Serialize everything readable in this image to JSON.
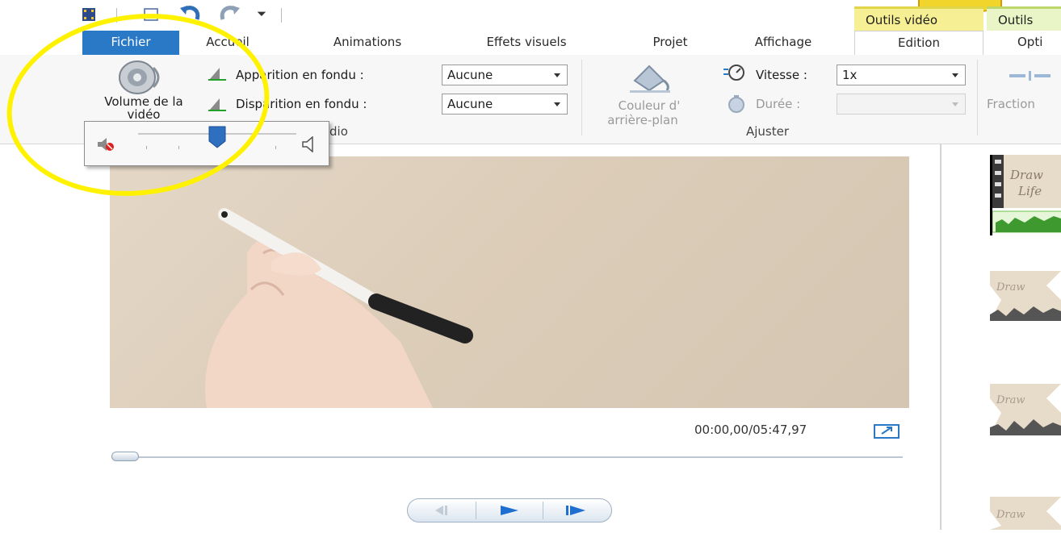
{
  "context_tabs": {
    "video_tools": "Outils vidéo",
    "other_tools": "Outils"
  },
  "tabs": [
    {
      "label": "Fichier"
    },
    {
      "label": "Accueil"
    },
    {
      "label": "Animations"
    },
    {
      "label": "Effets visuels"
    },
    {
      "label": "Projet"
    },
    {
      "label": "Affichage"
    },
    {
      "label": "Edition"
    },
    {
      "label": "Opti"
    }
  ],
  "ribbon": {
    "volume_button_label": "Volume de la vidéo",
    "fade_in_label": "Apparition en fondu :",
    "fade_in_value": "Aucune",
    "fade_out_label": "Disparition en fondu :",
    "fade_out_value": "Aucune",
    "audio_group_label": "dio",
    "bg_color_label": "Couleur d'",
    "bg_color_label_2": "arrière-plan",
    "speed_label": "Vitesse :",
    "speed_value": "1x",
    "duration_label": "Durée :",
    "duration_value": "",
    "adjust_group_label": "Ajuster",
    "fraction_label": "Fraction"
  },
  "volume_popup": {
    "level": 0.5
  },
  "player": {
    "timecode": "00:00,00/05:47,97",
    "position": 0.0
  },
  "storyboard": {
    "thumb_text_1": "Draw",
    "thumb_text_2": "Life"
  },
  "colors": {
    "file_tab": "#2a79c6",
    "context_header": "#f6ef93",
    "annotation": "#fff200"
  }
}
